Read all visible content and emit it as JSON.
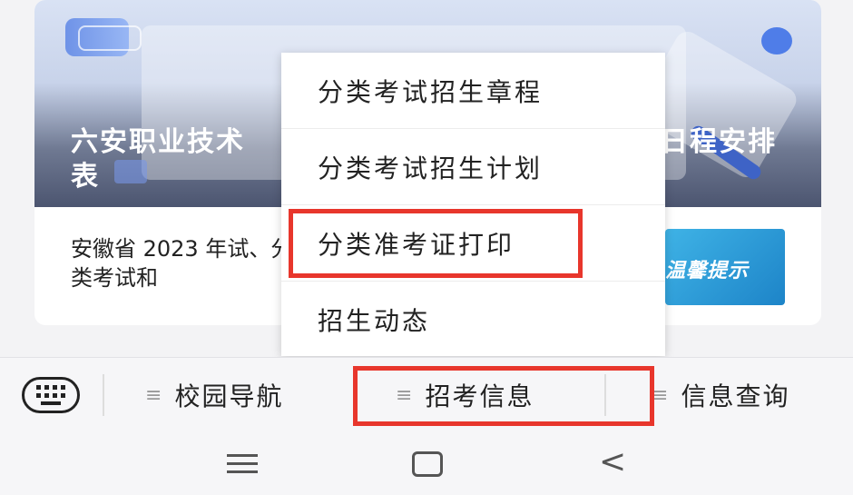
{
  "article": {
    "title_left": "六安职业技术",
    "title_right": "日程安排",
    "title_line2": "表",
    "snippet": "安徽省 2023 年试、分类考试和",
    "thumb_text": "温馨提示"
  },
  "menu": {
    "items": [
      {
        "label": "分类考试招生章程"
      },
      {
        "label": "分类考试招生计划"
      },
      {
        "label": "分类准考证打印"
      },
      {
        "label": "招生动态"
      }
    ]
  },
  "tabbar": {
    "tabs": [
      {
        "label": "校园导航"
      },
      {
        "label": "招考信息"
      },
      {
        "label": "信息查询"
      }
    ],
    "burger": "≡"
  },
  "colors": {
    "highlight": "#e8362c"
  },
  "icons": {
    "keyboard": "keyboard-icon",
    "menu": "menu-icon",
    "home": "home-icon",
    "back": "back-icon"
  }
}
